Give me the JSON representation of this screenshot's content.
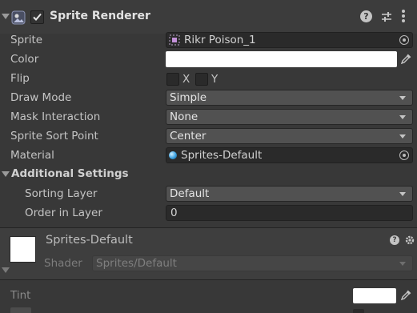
{
  "component": {
    "title": "Sprite Renderer",
    "enabled": true
  },
  "fields": {
    "sprite": {
      "label": "Sprite",
      "value": "Rikr Poison_1"
    },
    "color": {
      "label": "Color",
      "value_color": "#FFFFFF"
    },
    "flip": {
      "label": "Flip",
      "x_label": "X",
      "y_label": "Y",
      "x_checked": false,
      "y_checked": false
    },
    "draw_mode": {
      "label": "Draw Mode",
      "value": "Simple"
    },
    "mask_interaction": {
      "label": "Mask Interaction",
      "value": "None"
    },
    "sprite_sort_point": {
      "label": "Sprite Sort Point",
      "value": "Center"
    },
    "material": {
      "label": "Material",
      "value": "Sprites-Default"
    }
  },
  "additional_settings": {
    "label": "Additional Settings",
    "sorting_layer": {
      "label": "Sorting Layer",
      "value": "Default"
    },
    "order_in_layer": {
      "label": "Order in Layer",
      "value": "0"
    }
  },
  "material_section": {
    "name": "Sprites-Default",
    "shader_label": "Shader",
    "shader_value": "Sprites/Default",
    "tint_label": "Tint",
    "tint_color": "#FFFFFF"
  },
  "colors": {
    "background": "#383838",
    "header": "#3c3c3c",
    "field": "#2a2a2a",
    "dropdown": "#515151"
  }
}
